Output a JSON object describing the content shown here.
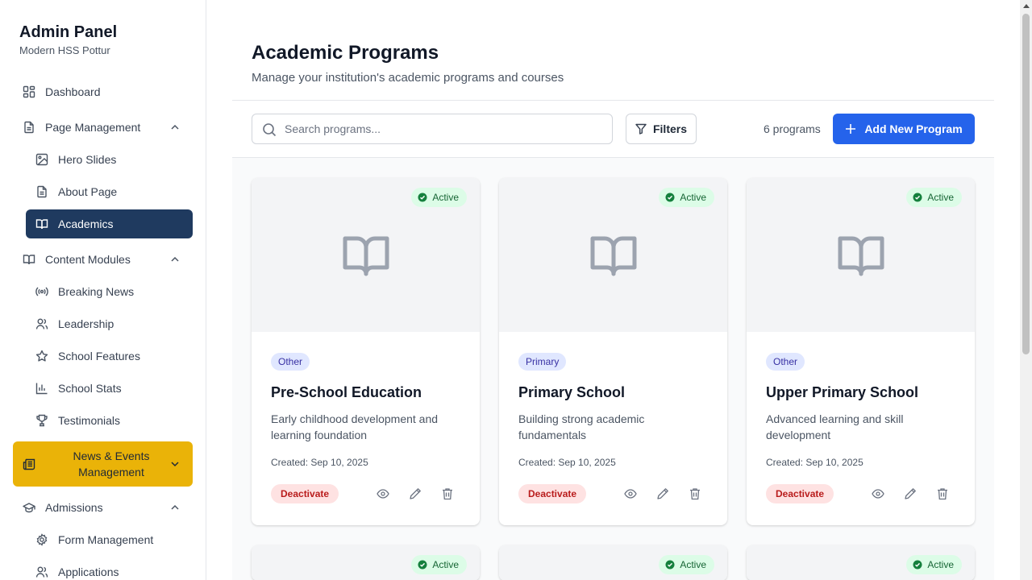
{
  "sidebar": {
    "title": "Admin Panel",
    "subtitle": "Modern HSS Pottur",
    "items": [
      {
        "label": "Dashboard",
        "icon": "layout-grid-icon"
      },
      {
        "label": "Page Management",
        "icon": "file-text-icon"
      },
      {
        "label": "Hero Slides",
        "icon": "image-icon"
      },
      {
        "label": "About Page",
        "icon": "file-text-icon"
      },
      {
        "label": "Academics",
        "icon": "book-open-icon"
      },
      {
        "label": "Content Modules",
        "icon": "book-open-icon"
      },
      {
        "label": "Breaking News",
        "icon": "radio-icon"
      },
      {
        "label": "Leadership",
        "icon": "users-icon"
      },
      {
        "label": "School Features",
        "icon": "star-icon"
      },
      {
        "label": "School Stats",
        "icon": "bar-chart-icon"
      },
      {
        "label": "Testimonials",
        "icon": "trophy-icon"
      },
      {
        "label": "News & Events Management",
        "icon": "newspaper-icon"
      },
      {
        "label": "Admissions",
        "icon": "graduation-cap-icon"
      },
      {
        "label": "Form Management",
        "icon": "settings-icon"
      },
      {
        "label": "Applications",
        "icon": "users-icon"
      }
    ]
  },
  "header": {
    "title": "Academic Programs",
    "subtitle": "Manage your institution's academic programs and courses"
  },
  "toolbar": {
    "search_placeholder": "Search programs...",
    "filters_label": "Filters",
    "count_label": "6 programs",
    "add_label": "Add New Program"
  },
  "colors": {
    "accent": "#2563eb",
    "sidebar_active": "#1f3a5f",
    "sidebar_highlight": "#eab308",
    "status_active_bg": "#dcfce7",
    "deactivate_bg": "#fee2e2"
  },
  "programs": [
    {
      "status": "Active",
      "category": "Other",
      "title": "Pre-School Education",
      "description": "Early childhood development and learning foundation",
      "created": "Created: Sep 10, 2025",
      "action": "Deactivate"
    },
    {
      "status": "Active",
      "category": "Primary",
      "title": "Primary School",
      "description": "Building strong academic fundamentals",
      "created": "Created: Sep 10, 2025",
      "action": "Deactivate"
    },
    {
      "status": "Active",
      "category": "Other",
      "title": "Upper Primary School",
      "description": "Advanced learning and skill development",
      "created": "Created: Sep 10, 2025",
      "action": "Deactivate"
    },
    {
      "status": "Active"
    },
    {
      "status": "Active"
    },
    {
      "status": "Active"
    }
  ]
}
